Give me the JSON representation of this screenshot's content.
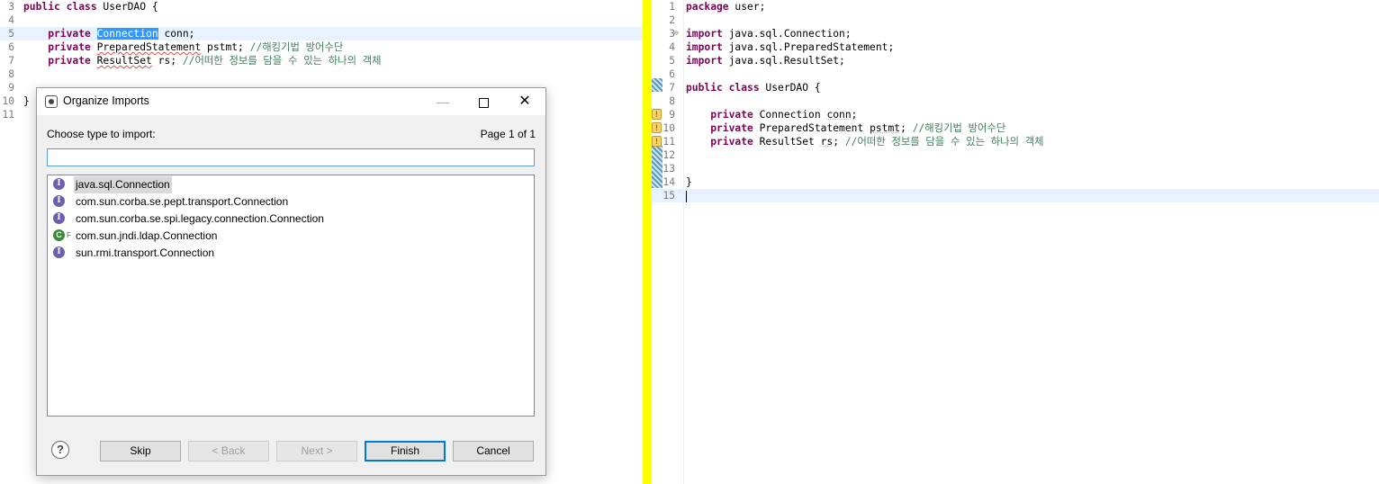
{
  "left_editor": {
    "lines": [
      {
        "num": "3",
        "parts": [
          {
            "t": "public class ",
            "c": "kw"
          },
          {
            "t": "UserDAO {",
            "c": ""
          }
        ]
      },
      {
        "num": "4",
        "parts": []
      },
      {
        "num": "5",
        "parts": [
          {
            "t": "    private ",
            "c": "kw"
          },
          {
            "t": "Connection",
            "c": "sel"
          },
          {
            "t": " conn;",
            "c": ""
          }
        ]
      },
      {
        "num": "6",
        "parts": [
          {
            "t": "    private ",
            "c": "kw"
          },
          {
            "t": "PreparedStatement",
            "c": "squig"
          },
          {
            "t": " pstmt; ",
            "c": ""
          },
          {
            "t": "//해킹기법 방어수단",
            "c": "cm"
          }
        ]
      },
      {
        "num": "7",
        "parts": [
          {
            "t": "    private ",
            "c": "kw"
          },
          {
            "t": "ResultSet",
            "c": "squig"
          },
          {
            "t": " rs; ",
            "c": ""
          },
          {
            "t": "//어떠한 정보를 담을 수 있는 하나의 객체",
            "c": "cm"
          }
        ]
      },
      {
        "num": "8",
        "parts": []
      },
      {
        "num": "9",
        "parts": []
      },
      {
        "num": "10",
        "parts": [
          {
            "t": "}",
            "c": ""
          }
        ]
      },
      {
        "num": "11",
        "parts": []
      }
    ]
  },
  "right_editor": {
    "lines": [
      {
        "num": "1",
        "parts": [
          {
            "t": "package ",
            "c": "kw"
          },
          {
            "t": "user;",
            "c": ""
          }
        ]
      },
      {
        "num": "2",
        "parts": []
      },
      {
        "num": "3",
        "fold": true,
        "parts": [
          {
            "t": "import ",
            "c": "kw"
          },
          {
            "t": "java.sql.Connection;",
            "c": ""
          }
        ]
      },
      {
        "num": "4",
        "parts": [
          {
            "t": "import ",
            "c": "kw"
          },
          {
            "t": "java.sql.PreparedStatement;",
            "c": ""
          }
        ]
      },
      {
        "num": "5",
        "parts": [
          {
            "t": "import ",
            "c": "kw"
          },
          {
            "t": "java.sql.ResultSet;",
            "c": ""
          }
        ]
      },
      {
        "num": "6",
        "parts": []
      },
      {
        "num": "7",
        "parts": [
          {
            "t": "public class ",
            "c": "kw"
          },
          {
            "t": "UserDAO {",
            "c": ""
          }
        ]
      },
      {
        "num": "8",
        "parts": []
      },
      {
        "num": "9",
        "warn": true,
        "parts": [
          {
            "t": "    private ",
            "c": "kw"
          },
          {
            "t": "Connection ",
            "c": ""
          },
          {
            "t": "conn",
            "c": "u-dot"
          },
          {
            "t": ";",
            "c": ""
          }
        ]
      },
      {
        "num": "10",
        "warn": true,
        "parts": [
          {
            "t": "    private ",
            "c": "kw"
          },
          {
            "t": "PreparedStatement ",
            "c": ""
          },
          {
            "t": "pstmt",
            "c": "u-dot"
          },
          {
            "t": "; ",
            "c": ""
          },
          {
            "t": "//해킹기법 방어수단",
            "c": "cm"
          }
        ]
      },
      {
        "num": "11",
        "warn": true,
        "parts": [
          {
            "t": "    private ",
            "c": "kw"
          },
          {
            "t": "ResultSet ",
            "c": ""
          },
          {
            "t": "rs",
            "c": "u-dot"
          },
          {
            "t": "; ",
            "c": ""
          },
          {
            "t": "//어떠한 정보를 담을 수 있는 하나의 객체",
            "c": "cm"
          }
        ]
      },
      {
        "num": "12",
        "parts": []
      },
      {
        "num": "13",
        "parts": []
      },
      {
        "num": "14",
        "parts": [
          {
            "t": "}",
            "c": ""
          }
        ]
      },
      {
        "num": "15",
        "cursor": true,
        "parts": []
      }
    ]
  },
  "dialog": {
    "title": "Organize Imports",
    "choose_label": "Choose type to import:",
    "page_info": "Page 1 of 1",
    "filter_value": "",
    "items": [
      {
        "label": "java.sql.Connection",
        "kind": "interface",
        "selected": true
      },
      {
        "label": "com.sun.corba.se.pept.transport.Connection",
        "kind": "interface"
      },
      {
        "label": "com.sun.corba.se.spi.legacy.connection.Connection",
        "kind": "interface"
      },
      {
        "label": "com.sun.jndi.ldap.Connection",
        "kind": "final-class"
      },
      {
        "label": "sun.rmi.transport.Connection",
        "kind": "interface"
      }
    ],
    "buttons": {
      "help": "?",
      "skip": "Skip",
      "back": "< Back",
      "next": "Next >",
      "finish": "Finish",
      "cancel": "Cancel"
    }
  },
  "colors": {
    "divider": "#ffff00",
    "keyword": "#7f0055",
    "comment": "#3f7f5f",
    "selection": "#3399ff"
  },
  "icons": {
    "interface": "interface-icon",
    "final_class": "final-class-icon",
    "dialog": "organize-imports-icon"
  }
}
